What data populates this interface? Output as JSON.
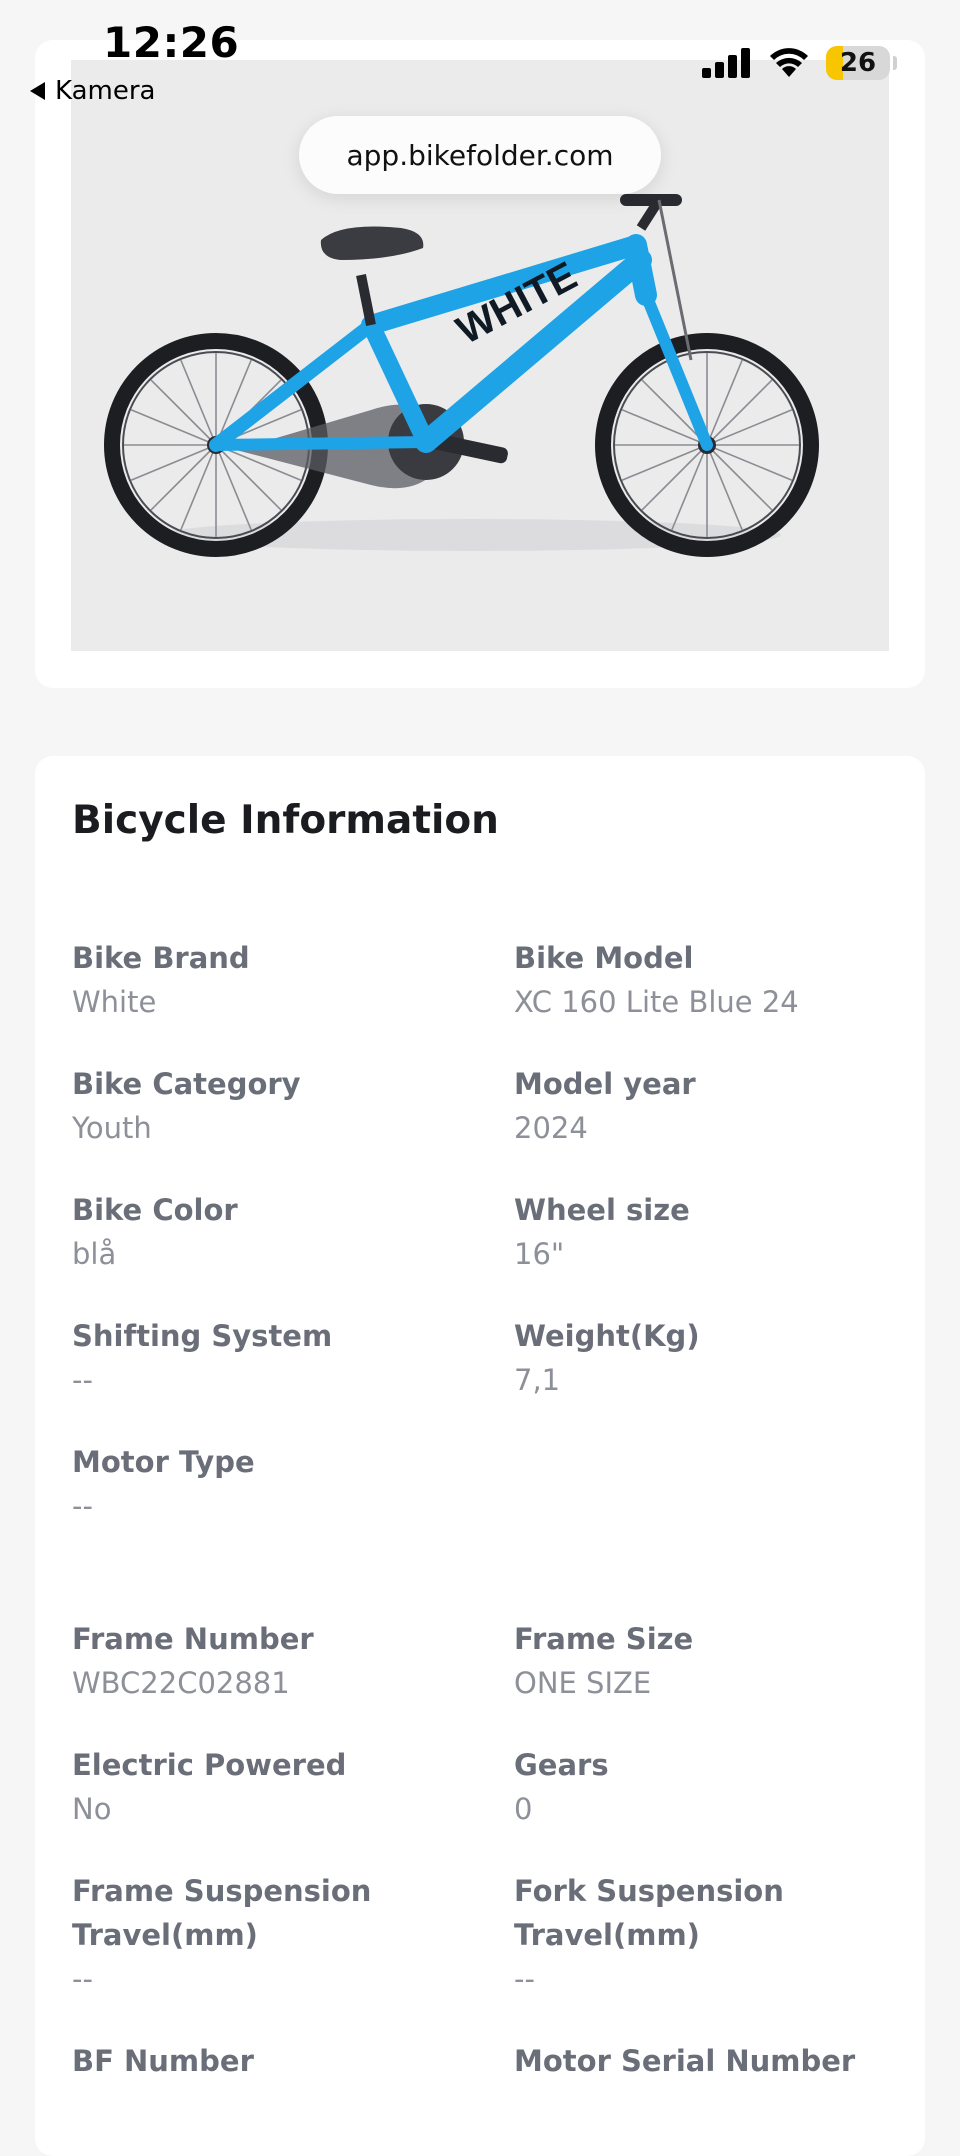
{
  "status_bar": {
    "time": "12:26",
    "back_label": "Kamera",
    "battery_level": "26"
  },
  "browser": {
    "url": "app.bikefolder.com"
  },
  "bike_image": {
    "frame_color": "#1ea3e6",
    "brand_mark": "WHITE"
  },
  "info": {
    "title": "Bicycle Information",
    "fields": [
      {
        "label": "Bike Brand",
        "value": "White"
      },
      {
        "label": "Bike Model",
        "value": "XC 160 Lite Blue 24"
      },
      {
        "label": "Bike Category",
        "value": "Youth"
      },
      {
        "label": "Model year",
        "value": "2024"
      },
      {
        "label": "Bike Color",
        "value": "blå"
      },
      {
        "label": "Wheel size",
        "value": "16\""
      },
      {
        "label": "Shifting System",
        "value": "--"
      },
      {
        "label": "Weight(Kg)",
        "value": "7,1"
      },
      {
        "label": "Motor Type",
        "value": "--"
      },
      {
        "label": "Frame Number",
        "value": "WBC22C02881"
      },
      {
        "label": "Frame Size",
        "value": "ONE SIZE"
      },
      {
        "label": "Electric Powered",
        "value": "No"
      },
      {
        "label": "Gears",
        "value": "0"
      },
      {
        "label": "Frame Suspension Travel(mm)",
        "value": "--"
      },
      {
        "label": "Fork Suspension Travel(mm)",
        "value": "--"
      },
      {
        "label": "BF Number",
        "value": ""
      },
      {
        "label": "Motor Serial Number",
        "value": ""
      }
    ]
  }
}
